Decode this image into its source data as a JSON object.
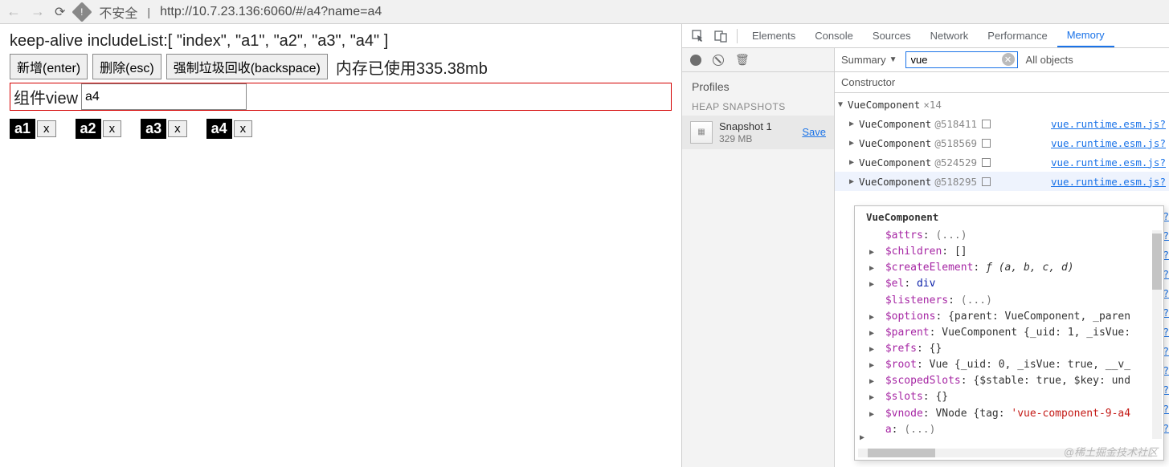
{
  "browser": {
    "security_label": "不安全",
    "url": "http://10.7.23.136:6060/#/a4?name=a4"
  },
  "page": {
    "heading": "keep-alive includeList:[ \"index\", \"a1\", \"a2\", \"a3\", \"a4\" ]",
    "btn_add": "新增(enter)",
    "btn_del": "删除(esc)",
    "btn_gc": "强制垃圾回收(backspace)",
    "mem_text": "内存已使用335.38mb",
    "view_label": "组件view",
    "view_value": "a4",
    "tabs": [
      {
        "name": "a1",
        "close": "x"
      },
      {
        "name": "a2",
        "close": "x"
      },
      {
        "name": "a3",
        "close": "x"
      },
      {
        "name": "a4",
        "close": "x"
      }
    ]
  },
  "devtools": {
    "tabs": [
      "Elements",
      "Console",
      "Sources",
      "Network",
      "Performance",
      "Memory"
    ],
    "active_tab": "Memory",
    "left": {
      "profiles": "Profiles",
      "section": "HEAP SNAPSHOTS",
      "snapshot_name": "Snapshot 1",
      "snapshot_size": "329 MB",
      "save": "Save"
    },
    "filter": {
      "summary": "Summary",
      "value": "vue",
      "all_objects": "All objects"
    },
    "header": "Constructor",
    "root": {
      "name": "VueComponent",
      "count": "×14"
    },
    "rows": [
      {
        "name": "VueComponent",
        "at": "@518411",
        "link": "vue.runtime.esm.js?"
      },
      {
        "name": "VueComponent",
        "at": "@518569",
        "link": "vue.runtime.esm.js?"
      },
      {
        "name": "VueComponent",
        "at": "@524529",
        "link": "vue.runtime.esm.js?"
      },
      {
        "name": "VueComponent",
        "at": "@518295",
        "link": "vue.runtime.esm.js?"
      }
    ],
    "detail_title": "VueComponent",
    "props": [
      {
        "tri": "",
        "key": "$attrs",
        "val": "(...)",
        "cls": "pv-gray"
      },
      {
        "tri": "▶",
        "key": "$children",
        "val": "[]",
        "cls": ""
      },
      {
        "tri": "▶",
        "key": "$createElement",
        "val": "ƒ (a, b, c, d)",
        "cls": "pv-italic"
      },
      {
        "tri": "▶",
        "key": "$el",
        "val": "div",
        "cls": "pv-blue"
      },
      {
        "tri": "",
        "key": "$listeners",
        "val": "(...)",
        "cls": "pv-gray"
      },
      {
        "tri": "▶",
        "key": "$options",
        "val": "{parent: VueComponent, _paren",
        "cls": ""
      },
      {
        "tri": "▶",
        "key": "$parent",
        "val": "VueComponent {_uid: 1, _isVue:",
        "cls": ""
      },
      {
        "tri": "▶",
        "key": "$refs",
        "val": "{}",
        "cls": ""
      },
      {
        "tri": "▶",
        "key": "$root",
        "val": "Vue {_uid: 0, _isVue: true, __v_",
        "cls": ""
      },
      {
        "tri": "▶",
        "key": "$scopedSlots",
        "val": "{$stable: true, $key: und",
        "cls": ""
      },
      {
        "tri": "▶",
        "key": "$slots",
        "val": "{}",
        "cls": ""
      },
      {
        "tri": "▶",
        "key": "$vnode",
        "val": "VNode {tag: 'vue-component-9-a4",
        "cls": ""
      },
      {
        "tri": "",
        "key": "a",
        "val": "(...)",
        "cls": "pv-gray"
      }
    ],
    "hidden_links": [
      "s?",
      "s?",
      "s?",
      "s?",
      "s?",
      "s?",
      "s?",
      "s?",
      "s?",
      "s?",
      "s?",
      "s?"
    ]
  },
  "watermark": "@稀土掘金技术社区"
}
